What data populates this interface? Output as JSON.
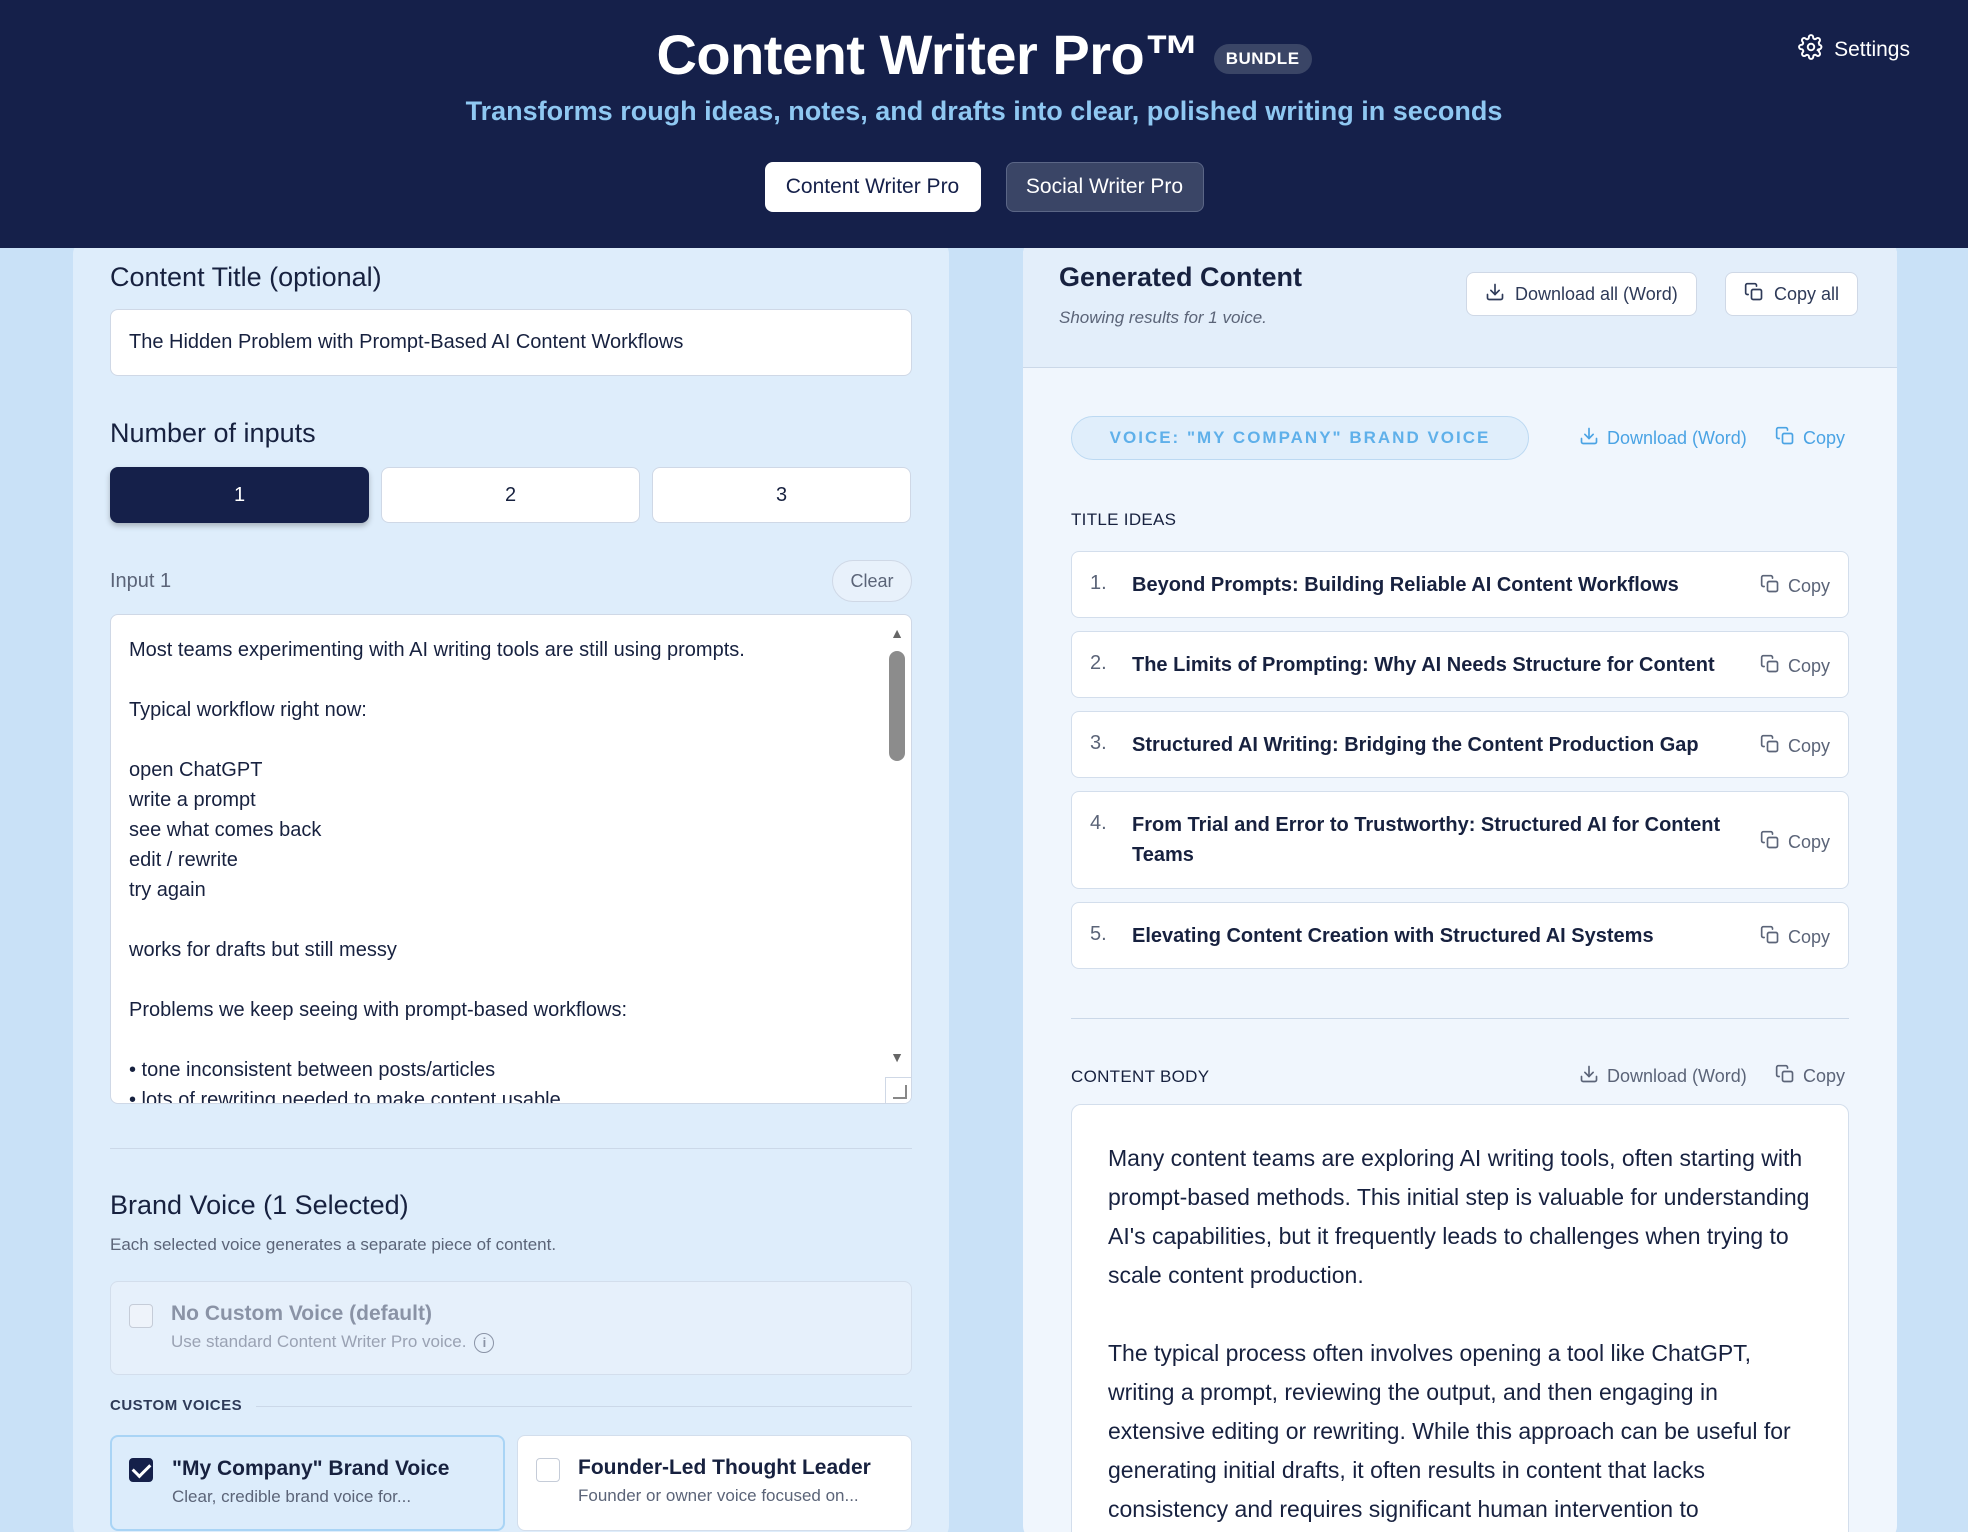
{
  "header": {
    "title": "Content Writer Pro™",
    "badge": "BUNDLE",
    "tagline": "Transforms rough ideas, notes, and drafts into clear, polished writing in seconds",
    "tabs": [
      {
        "label": "Content Writer Pro",
        "active": true
      },
      {
        "label": "Social Writer Pro",
        "active": false
      }
    ],
    "settings_label": "Settings"
  },
  "left": {
    "content_title_label": "Content Title (optional)",
    "content_title_value": "The Hidden Problem with Prompt-Based AI Content Workflows",
    "num_inputs_label": "Number of inputs",
    "num_inputs_options": [
      "1",
      "2",
      "3"
    ],
    "num_inputs_selected": "1",
    "input_label": "Input 1",
    "clear_label": "Clear",
    "input_text": "Most teams experimenting with AI writing tools are still using prompts.\n\nTypical workflow right now:\n\nopen ChatGPT\nwrite a prompt\nsee what comes back\nedit / rewrite\ntry again\n\nworks for drafts but still messy\n\nProblems we keep seeing with prompt-based workflows:\n\n• tone inconsistent between posts/articles\n• lots of rewriting needed to make content usable",
    "brand_voice_heading": "Brand Voice (1 Selected)",
    "brand_voice_sub": "Each selected voice generates a separate piece of content.",
    "default_voice": {
      "name": "No Custom Voice (default)",
      "desc": "Use standard Content Writer Pro voice.",
      "checked": false
    },
    "custom_voices_label": "CUSTOM VOICES",
    "custom_voices": [
      {
        "name": "\"My Company\" Brand Voice",
        "desc": "Clear, credible brand voice for...",
        "checked": true
      },
      {
        "name": "Founder-Led Thought Leader",
        "desc": "Founder or owner voice focused on...",
        "checked": false
      }
    ]
  },
  "right": {
    "heading": "Generated Content",
    "sub": "Showing results for 1 voice.",
    "download_all_label": "Download all (Word)",
    "copy_all_label": "Copy all",
    "voice_pill": "VOICE: \"MY COMPANY\" BRAND VOICE",
    "download_word_label": "Download (Word)",
    "copy_label": "Copy",
    "title_ideas_label": "TITLE IDEAS",
    "title_ideas": [
      {
        "num": "1.",
        "text": "Beyond Prompts: Building Reliable AI Content Workflows"
      },
      {
        "num": "2.",
        "text": "The Limits of Prompting: Why AI Needs Structure for Content"
      },
      {
        "num": "3.",
        "text": "Structured AI Writing: Bridging the Content Production Gap"
      },
      {
        "num": "4.",
        "text": "From Trial and Error to Trustworthy: Structured AI for Content Teams"
      },
      {
        "num": "5.",
        "text": "Elevating Content Creation with Structured AI Systems"
      }
    ],
    "content_body_label": "CONTENT BODY",
    "content_body_paragraphs": [
      "Many content teams are exploring AI writing tools, often starting with prompt-based methods. This initial step is valuable for understanding AI's capabilities, but it frequently leads to challenges when trying to scale content production.",
      "The typical process often involves opening a tool like ChatGPT, writing a prompt, reviewing the output, and then engaging in extensive editing or rewriting. While this approach can be useful for generating initial drafts, it often results in content that lacks consistency and requires significant human intervention to"
    ]
  }
}
